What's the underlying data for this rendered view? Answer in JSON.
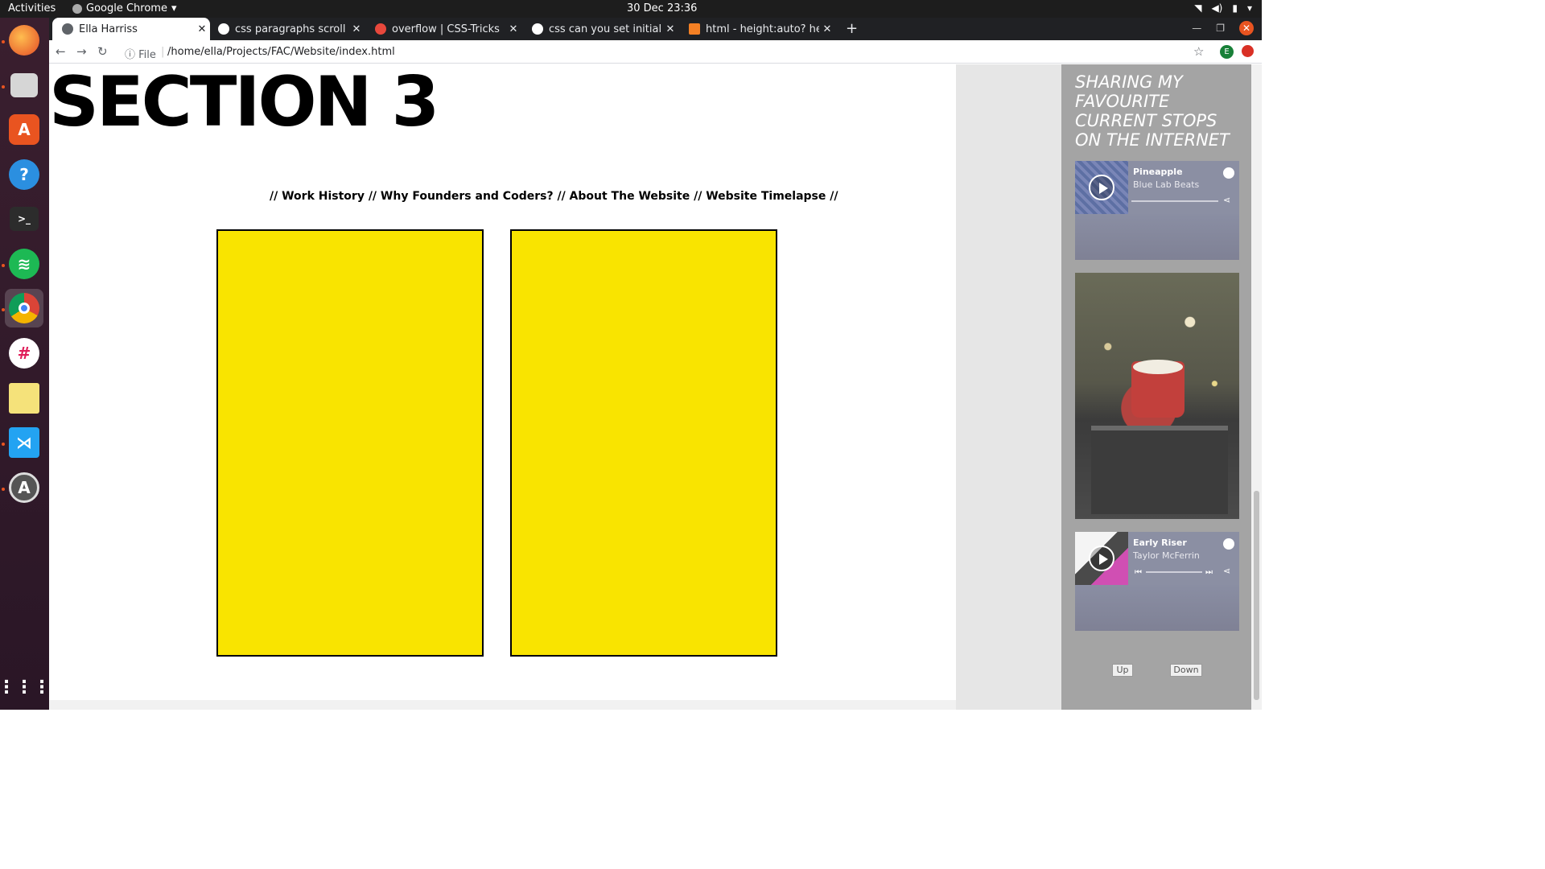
{
  "system": {
    "activities": "Activities",
    "app_name": "Google Chrome",
    "clock": "30 Dec  23:36"
  },
  "browser": {
    "tabs": [
      {
        "title": "Ella Harriss",
        "active": true
      },
      {
        "title": "css paragraphs scroll hide",
        "active": false
      },
      {
        "title": "overflow | CSS-Tricks",
        "active": false
      },
      {
        "title": "css can you set initial heig",
        "active": false
      },
      {
        "title": "html - height:auto? height",
        "active": false
      }
    ],
    "file_label": "File",
    "url": "/home/ella/Projects/FAC/Website/index.html",
    "profile_initial": "E"
  },
  "page": {
    "section_title": "SECTION 3",
    "nav_links": "// Work History // Why Founders and Coders? // About The Website // Website Timelapse //",
    "card_color": "#f9e400"
  },
  "sidebar": {
    "title": "SHARING MY FAVOURITE CURRENT STOPS ON THE INTERNET",
    "players": [
      {
        "song": "Pineapple",
        "artist": "Blue Lab Beats"
      },
      {
        "song": "Early Riser",
        "artist": "Taylor McFerrin"
      }
    ],
    "up_label": "Up",
    "down_label": "Down"
  },
  "colors": {
    "accent_ubuntu": "#e95420",
    "spotify_green": "#1db954",
    "sidebar_bg": "#a4a4a4"
  }
}
